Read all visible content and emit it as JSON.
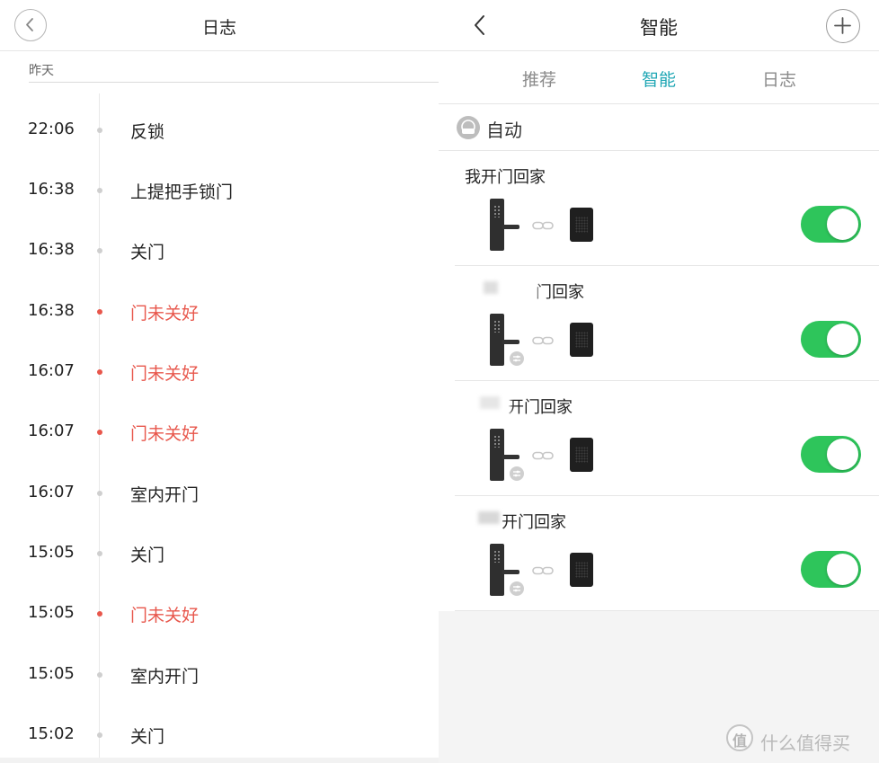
{
  "colors": {
    "accent": "#21a7b5",
    "warning": "#e8574c",
    "toggle_on": "#2ec55b"
  },
  "log": {
    "title": "日志",
    "back_icon": "circle-back-icon",
    "section_label": "昨天",
    "entries": [
      {
        "time": "22:06",
        "event": "反锁",
        "warn": false
      },
      {
        "time": "16:38",
        "event": "上提把手锁门",
        "warn": false
      },
      {
        "time": "16:38",
        "event": "关门",
        "warn": false
      },
      {
        "time": "16:38",
        "event": "门未关好",
        "warn": true
      },
      {
        "time": "16:07",
        "event": "门未关好",
        "warn": true
      },
      {
        "time": "16:07",
        "event": "门未关好",
        "warn": true
      },
      {
        "time": "16:07",
        "event": "室内开门",
        "warn": false
      },
      {
        "time": "15:05",
        "event": "关门",
        "warn": false
      },
      {
        "time": "15:05",
        "event": "门未关好",
        "warn": true
      },
      {
        "time": "15:05",
        "event": "室内开门",
        "warn": false
      },
      {
        "time": "15:02",
        "event": "关门",
        "warn": false
      }
    ]
  },
  "smart": {
    "title": "智能",
    "back_icon": "chevron-left-icon",
    "add_icon": "plus-icon",
    "tabs": [
      {
        "label": "推荐",
        "active": false
      },
      {
        "label": "智能",
        "active": true
      },
      {
        "label": "日志",
        "active": false
      }
    ],
    "section_icon": "robot-icon",
    "section_title": "自动",
    "automations": [
      {
        "name": "我开门回家",
        "enabled": true,
        "trigger_icon": "smart-lock-icon",
        "link_icon": "link-icon",
        "action_icon": "gateway-speaker-icon"
      },
      {
        "name": "门回家",
        "enabled": true,
        "trigger_icon": "smart-lock-icon",
        "link_icon": "link-icon",
        "action_icon": "gateway-speaker-icon"
      },
      {
        "name": "开门回家",
        "enabled": true,
        "trigger_icon": "smart-lock-icon",
        "link_icon": "link-icon",
        "action_icon": "gateway-speaker-icon"
      },
      {
        "name": "开门回家",
        "enabled": true,
        "trigger_icon": "smart-lock-icon",
        "link_icon": "link-icon",
        "action_icon": "gateway-speaker-icon"
      }
    ]
  },
  "watermark": {
    "logo_text": "值",
    "text": "什么值得买"
  }
}
